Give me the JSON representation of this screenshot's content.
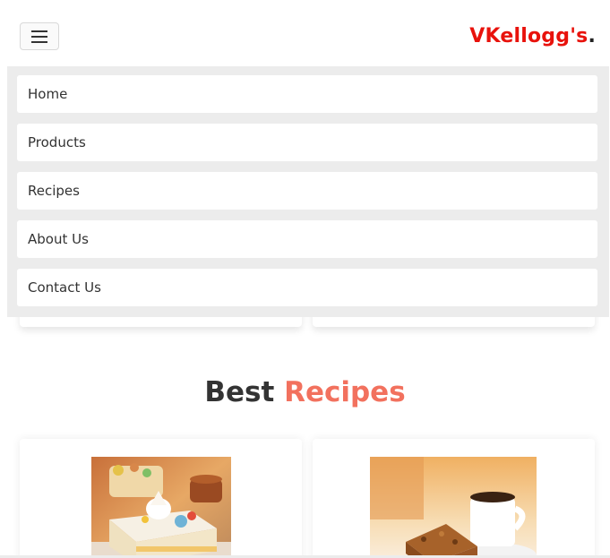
{
  "header": {
    "logo_text": "VKellogg's",
    "logo_dot": ".",
    "menu_toggle_icon": "hamburger-icon"
  },
  "nav": {
    "items": [
      {
        "label": "Home"
      },
      {
        "label": "Products"
      },
      {
        "label": "Recipes"
      },
      {
        "label": "About Us"
      },
      {
        "label": "Contact Us"
      }
    ]
  },
  "section": {
    "title_main": "Best",
    "title_accent": "Recipes"
  },
  "recipes": [
    {
      "image": "layered-dessert-bar-image"
    },
    {
      "image": "coffee-and-cake-image"
    }
  ],
  "colors": {
    "brand_red": "#e8120c",
    "accent_salmon": "#f2715e",
    "nav_panel_bg": "#ececec"
  }
}
